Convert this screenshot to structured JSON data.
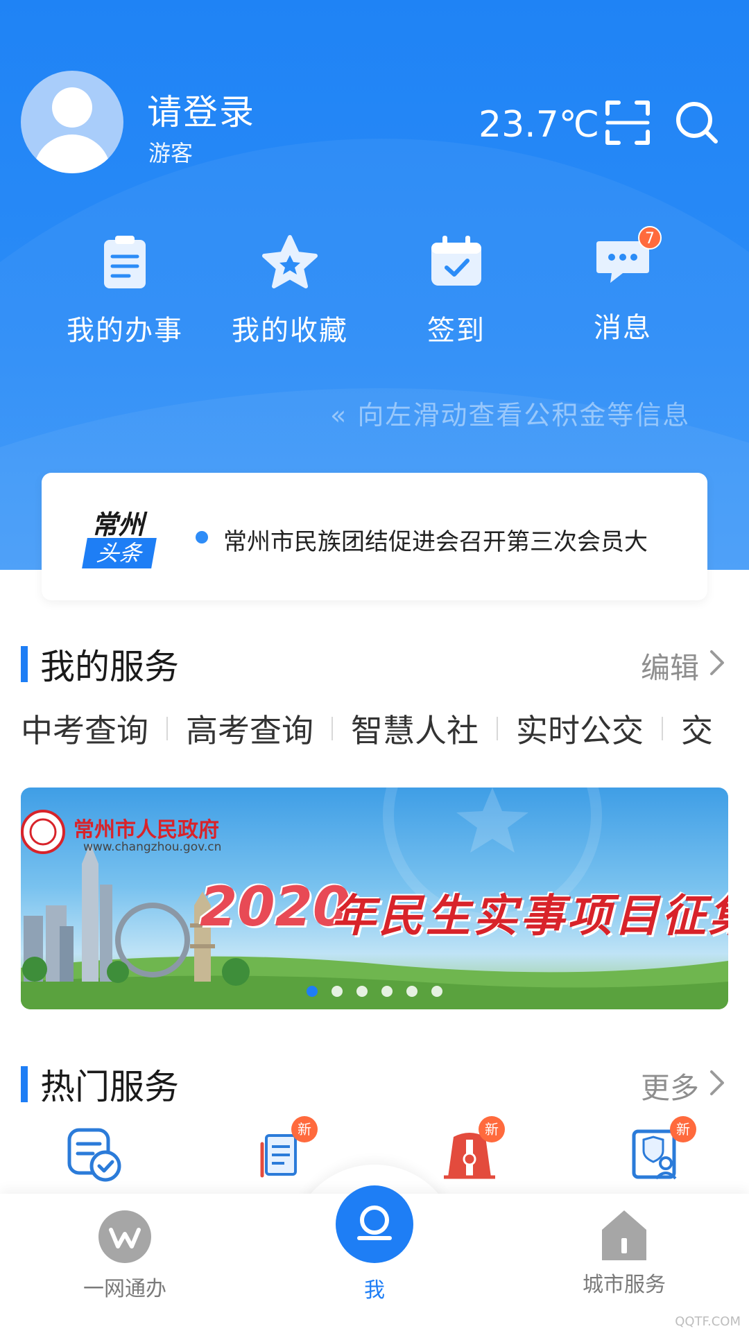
{
  "header": {
    "login_title": "请登录",
    "login_subtitle": "游客",
    "temperature": "23.7℃",
    "scan_icon": "scan-icon",
    "search_icon": "search-icon",
    "quick_actions": [
      {
        "label": "我的办事",
        "icon": "clipboard-icon"
      },
      {
        "label": "我的收藏",
        "icon": "star-icon"
      },
      {
        "label": "签到",
        "icon": "calendar-check-icon"
      },
      {
        "label": "消息",
        "icon": "chat-bubble-icon",
        "badge": "7"
      }
    ],
    "swipe_hint": "« 向左滑动查看公积金等信息"
  },
  "news": {
    "logo_line1": "常州",
    "logo_line2": "头条",
    "headline": "常州市民族团结促进会召开第三次会员大"
  },
  "my_services": {
    "title": "我的服务",
    "edit_label": "编辑",
    "items": [
      "中考查询",
      "高考查询",
      "智慧人社",
      "实时公交",
      "交"
    ]
  },
  "banner": {
    "org_name": "常州市人民政府",
    "url": "www.changzhou.gov.cn",
    "year": "2020",
    "slogan": "年民生实事项目征集",
    "dots_count": 6,
    "active_dot": 0
  },
  "hot_services": {
    "title": "热门服务",
    "more_label": "更多",
    "items": [
      {
        "icon": "vehicle-check-icon",
        "badge": ""
      },
      {
        "icon": "document-edit-icon",
        "badge": "新"
      },
      {
        "icon": "building-gate-icon",
        "badge": "新"
      },
      {
        "icon": "insurance-person-icon",
        "badge": "新"
      }
    ]
  },
  "bottom_nav": {
    "items": [
      {
        "label": "一网通办",
        "icon": "w-logo-icon",
        "active": false
      },
      {
        "label": "我",
        "icon": "profile-icon",
        "active": true
      },
      {
        "label": "城市服务",
        "icon": "house-icon",
        "active": false
      }
    ]
  },
  "watermark": "QQTF.COM",
  "colors": {
    "primary": "#1e7ef5",
    "header_bg": "#2b8cf7",
    "badge": "#ff6a3d",
    "banner_red": "#d8232a"
  }
}
